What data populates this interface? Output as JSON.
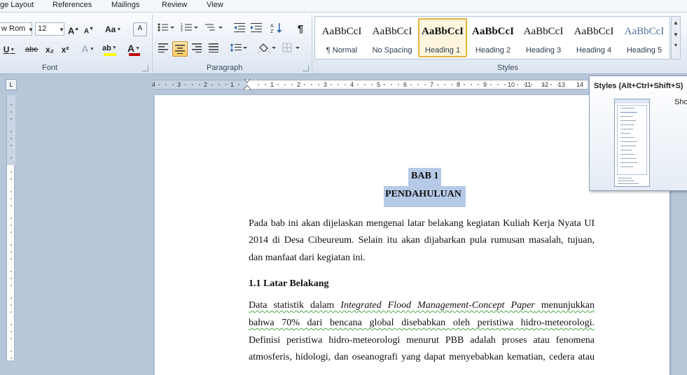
{
  "tabs": [
    "ge Layout",
    "References",
    "Mailings",
    "Review",
    "View"
  ],
  "font_group": {
    "label": "Font",
    "font_name": "w Rom",
    "font_size": "12",
    "grow_label": "A",
    "shrink_label": "A",
    "case_label": "Aa",
    "clear_label": "A",
    "underline_label": "U",
    "strike_label": "abe",
    "subscript_label": "x₂",
    "superscript_label": "x²",
    "effects_label": "A",
    "highlight_label": "ab",
    "color_label": "A"
  },
  "paragraph_group": {
    "label": "Paragraph",
    "pilcrow": "¶"
  },
  "styles_group": {
    "label": "Styles",
    "items": [
      {
        "sample": "AaBbCcI",
        "name": "¶ Normal"
      },
      {
        "sample": "AaBbCcI",
        "name": "No Spacing"
      },
      {
        "sample": "AaBbCcI",
        "name": "Heading 1"
      },
      {
        "sample": "AaBbCcI",
        "name": "Heading 2"
      },
      {
        "sample": "AaBbCcI",
        "name": "Heading 3"
      },
      {
        "sample": "AaBbCcI",
        "name": "Heading 4"
      },
      {
        "sample": "AaBbCcI",
        "name": "Heading 5"
      }
    ],
    "selected_index": 2
  },
  "tooltip": {
    "title": "Styles (Alt+Ctrl+Shift+S)",
    "text": "Sho"
  },
  "ruler_numbers": [
    "4",
    "3",
    "2",
    "1",
    "1",
    "2",
    "3",
    "4",
    "5",
    "6",
    "7",
    "8",
    "9",
    "10",
    "11",
    "12",
    "13",
    "14"
  ],
  "document": {
    "heading1": "BAB 1",
    "heading2": "PENDAHULUAN",
    "para1": [
      "Pada bab ini akan dijelaskan mengenai latar belakang kegiatan Kuliah Kerja Nyata UI",
      "2014 di Desa Cibeureum. Selain itu akan dijabarkan pula rumusan masalah, tujuan,",
      "dan manfaat dari kegiatan ini."
    ],
    "section_title": "1.1 Latar Belakang",
    "para2_line1_pre": "Data statistik dalam ",
    "para2_line1_italic": "Integrated Flood Management-Concept Paper",
    "para2_line1_post": " menunjukkan",
    "para2_line2": "bahwa 70% dari bencana global disebabkan oleh peristiwa hidro-meteorologi.",
    "para2_line3": "Definisi peristiwa hidro-meteorologi menurut PBB adalah proses atau fenomena",
    "para2_line4": "atmosferis, hidologi, dan oseanografi yang dapat menyebabkan kematian, cedera atau"
  },
  "colors": {
    "selection": "#b6cae8",
    "highlight_active": "#f8cb62",
    "font_color_bar": "#c00000",
    "highlight_bar": "#ffff00"
  }
}
